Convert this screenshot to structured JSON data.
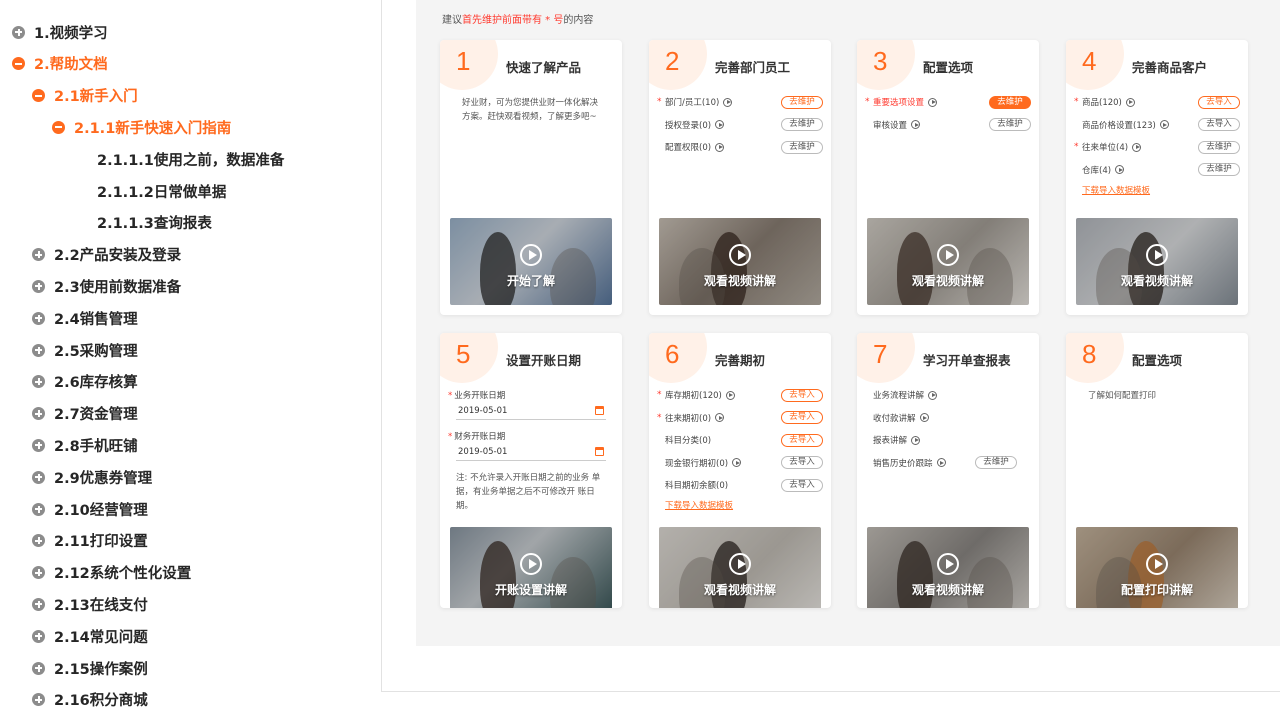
{
  "sidebar": {
    "items": [
      {
        "label": "1.视频学习",
        "state": "collapsed"
      },
      {
        "label": "2.帮助文档",
        "state": "expanded"
      },
      {
        "label": "2.1新手入门",
        "state": "expanded"
      },
      {
        "label": "2.1.1新手快速入门指南",
        "state": "expanded"
      },
      {
        "label": "2.1.1.1使用之前，数据准备",
        "state": "leaf"
      },
      {
        "label": "2.1.1.2日常做单据",
        "state": "leaf"
      },
      {
        "label": "2.1.1.3查询报表",
        "state": "leaf"
      },
      {
        "label": "2.2产品安装及登录",
        "state": "collapsed"
      },
      {
        "label": "2.3使用前数据准备",
        "state": "collapsed"
      },
      {
        "label": "2.4销售管理",
        "state": "collapsed"
      },
      {
        "label": "2.5采购管理",
        "state": "collapsed"
      },
      {
        "label": "2.6库存核算",
        "state": "collapsed"
      },
      {
        "label": "2.7资金管理",
        "state": "collapsed"
      },
      {
        "label": "2.8手机旺铺",
        "state": "collapsed"
      },
      {
        "label": "2.9优惠券管理",
        "state": "collapsed"
      },
      {
        "label": "2.10经营管理",
        "state": "collapsed"
      },
      {
        "label": "2.11打印设置",
        "state": "collapsed"
      },
      {
        "label": "2.12系统个性化设置",
        "state": "collapsed"
      },
      {
        "label": "2.13在线支付",
        "state": "collapsed"
      },
      {
        "label": "2.14常见问题",
        "state": "collapsed"
      },
      {
        "label": "2.15操作案例",
        "state": "collapsed"
      },
      {
        "label": "2.16积分商城",
        "state": "collapsed"
      }
    ]
  },
  "hint": {
    "pre": "建议",
    "red": "首先维护前面带有 * 号",
    "post": "的内容"
  },
  "cards": [
    {
      "num": "1",
      "title": "快速了解产品",
      "desc": "好业财，可为您提供业财一体化解决方案。赶快观看视频，了解更多吧~",
      "video": "开始了解"
    },
    {
      "num": "2",
      "title": "完善部门员工",
      "rows": [
        {
          "label": "部门/员工(10)",
          "star": true,
          "play": true,
          "btn": "去维护",
          "btn_style": "orange"
        },
        {
          "label": "授权登录(0)",
          "star": false,
          "play": true,
          "btn": "去维护",
          "btn_style": "gray"
        },
        {
          "label": "配置权限(0)",
          "star": false,
          "play": true,
          "btn": "去维护",
          "btn_style": "gray"
        }
      ],
      "video": "观看视频讲解"
    },
    {
      "num": "3",
      "title": "配置选项",
      "rows": [
        {
          "label": "重要选项设置",
          "star": true,
          "red": true,
          "play": true,
          "btn": "去维护",
          "btn_style": "filled"
        },
        {
          "label": "审核设置",
          "star": false,
          "play": true,
          "btn": "去维护",
          "btn_style": "gray"
        }
      ],
      "video": "观看视频讲解"
    },
    {
      "num": "4",
      "title": "完善商品客户",
      "rows": [
        {
          "label": "商品(120)",
          "star": true,
          "play": true,
          "btn": "去导入",
          "btn_style": "orange"
        },
        {
          "label": "商品价格设置(123)",
          "star": false,
          "play": true,
          "btn": "去导入",
          "btn_style": "gray"
        },
        {
          "label": "往来单位(4)",
          "star": true,
          "play": true,
          "btn": "去维护",
          "btn_style": "gray"
        },
        {
          "label": "仓库(4)",
          "star": false,
          "play": true,
          "btn": "去维护",
          "btn_style": "gray"
        }
      ],
      "link": "下载导入数据模板",
      "video": "观看视频讲解"
    },
    {
      "num": "5",
      "title": "设置开账日期",
      "dates": [
        {
          "label": "业务开账日期",
          "value": "2019-05-01"
        },
        {
          "label": "财务开账日期",
          "value": "2019-05-01"
        }
      ],
      "note": "注: 不允许录入开账日期之前的业务 单据，有业务单据之后不可修改开 账日期。",
      "video": "开账设置讲解"
    },
    {
      "num": "6",
      "title": "完善期初",
      "rows": [
        {
          "label": "库存期初(120)",
          "star": true,
          "play": true,
          "btn": "去导入",
          "btn_style": "orange"
        },
        {
          "label": "往来期初(0)",
          "star": true,
          "play": true,
          "btn": "去导入",
          "btn_style": "orange"
        },
        {
          "label": "科目分类(0)",
          "star": false,
          "play": false,
          "btn": "去导入",
          "btn_style": "orange"
        },
        {
          "label": "现金银行期初(0)",
          "star": false,
          "play": true,
          "btn": "去导入",
          "btn_style": "gray"
        },
        {
          "label": "科目期初余额(0)",
          "star": false,
          "play": false,
          "btn": "去导入",
          "btn_style": "gray"
        }
      ],
      "link": "下载导入数据模板",
      "video": "观看视频讲解"
    },
    {
      "num": "7",
      "title": "学习开单查报表",
      "rows": [
        {
          "label": "业务流程讲解",
          "star": false,
          "play": true
        },
        {
          "label": "收付款讲解",
          "star": false,
          "play": true
        },
        {
          "label": "报表讲解",
          "star": false,
          "play": true
        },
        {
          "label": "销售历史价跟踪",
          "star": false,
          "play": true,
          "btn": "去维护",
          "btn_style": "gray",
          "btn_inline": true
        }
      ],
      "video": "观看视频讲解"
    },
    {
      "num": "8",
      "title": "配置选项",
      "desc": "了解如何配置打印",
      "video": "配置打印讲解"
    }
  ],
  "colors": {
    "accent": "#ff6a1e",
    "required": "#ff3b30",
    "panel": "#f4f4f4"
  },
  "icons": {
    "expanded": "minus-circle-icon",
    "collapsed": "plus-circle-icon",
    "play": "play-circle-icon",
    "calendar": "calendar-icon"
  }
}
